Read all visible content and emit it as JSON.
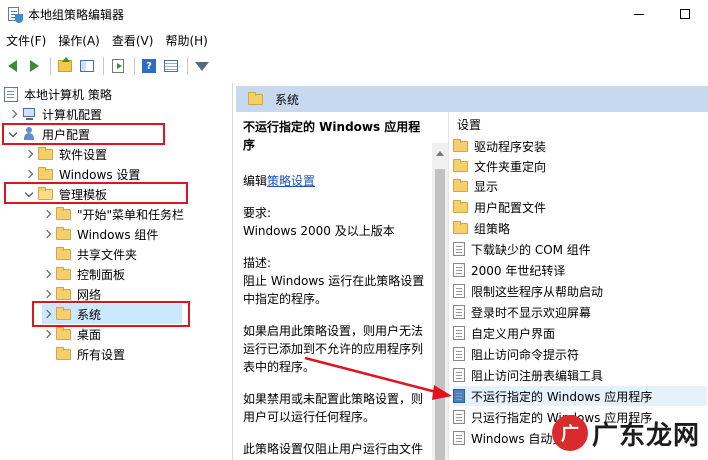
{
  "window": {
    "title": "本地组策略编辑器"
  },
  "menu": [
    "文件(F)",
    "操作(A)",
    "查看(V)",
    "帮助(H)"
  ],
  "toolbar": {
    "icons": [
      "back-arrow-icon",
      "forward-arrow-icon",
      "up-folder-icon",
      "show-hide-tree-icon",
      "export-list-icon",
      "help-icon",
      "view-icon",
      "filter-icon"
    ],
    "help_glyph": "?"
  },
  "tree": {
    "root": "本地计算机 策略",
    "computer_config": "计算机配置",
    "user_config": "用户配置",
    "software_settings": "软件设置",
    "windows_settings": "Windows 设置",
    "admin_templates": "管理模板",
    "start_menu": "\"开始\"菜单和任务栏",
    "windows_components": "Windows 组件",
    "shared_folders": "共享文件夹",
    "control_panel": "控制面板",
    "network": "网络",
    "system": "系统",
    "desktop": "桌面",
    "all_settings": "所有设置"
  },
  "middle": {
    "header": "系统",
    "policy_title": "不运行指定的 Windows 应用程序",
    "edit_prefix": "编辑",
    "edit_link": "策略设置",
    "req_label": "要求:",
    "req_value": "Windows 2000 及以上版本",
    "desc_label": "描述:",
    "desc_text": "阻止 Windows 运行在此策略设置中指定的程序。",
    "enabled_text": "如果启用此策略设置，则用户无法运行已添加到不允许的应用程序列表中的程序。",
    "disabled_text": "如果禁用或未配置此策略设置，则用户可以运行任何程序。",
    "extra_text": "此策略设置仅阻止用户运行由文件资源管理器进程启动的程序。它不"
  },
  "list": {
    "header": "设置",
    "folders": [
      "驱动程序安装",
      "文件夹重定向",
      "显示",
      "用户配置文件",
      "组策略"
    ],
    "settings": [
      "下载缺少的 COM 组件",
      "2000 年世纪转译",
      "限制这些程序从帮助启动",
      "登录时不显示欢迎屏幕",
      "自定义用户界面",
      "阻止访问命令提示符",
      "阻止访问注册表编辑工具",
      "不运行指定的 Windows 应用程序",
      "只运行指定的 Windows 应用程序",
      "Windows 自动更新"
    ]
  },
  "watermark": {
    "logo": "广",
    "text": "广东龙网"
  },
  "colors": {
    "highlight_red": "#e0141f",
    "header_blue": "#c6d9ef",
    "link_blue": "#1a56b5",
    "tree_selection": "#cce8ff"
  }
}
